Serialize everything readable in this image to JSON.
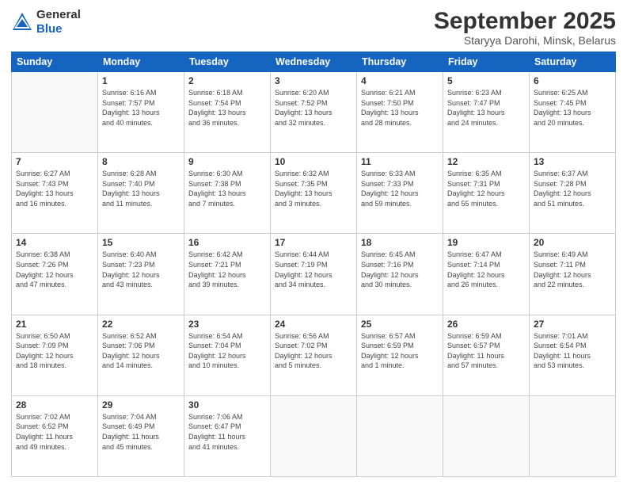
{
  "header": {
    "logo_line1": "General",
    "logo_line2": "Blue",
    "month": "September 2025",
    "location": "Staryya Darohi, Minsk, Belarus"
  },
  "weekdays": [
    "Sunday",
    "Monday",
    "Tuesday",
    "Wednesday",
    "Thursday",
    "Friday",
    "Saturday"
  ],
  "weeks": [
    [
      {
        "day": "",
        "text": ""
      },
      {
        "day": "1",
        "text": "Sunrise: 6:16 AM\nSunset: 7:57 PM\nDaylight: 13 hours\nand 40 minutes."
      },
      {
        "day": "2",
        "text": "Sunrise: 6:18 AM\nSunset: 7:54 PM\nDaylight: 13 hours\nand 36 minutes."
      },
      {
        "day": "3",
        "text": "Sunrise: 6:20 AM\nSunset: 7:52 PM\nDaylight: 13 hours\nand 32 minutes."
      },
      {
        "day": "4",
        "text": "Sunrise: 6:21 AM\nSunset: 7:50 PM\nDaylight: 13 hours\nand 28 minutes."
      },
      {
        "day": "5",
        "text": "Sunrise: 6:23 AM\nSunset: 7:47 PM\nDaylight: 13 hours\nand 24 minutes."
      },
      {
        "day": "6",
        "text": "Sunrise: 6:25 AM\nSunset: 7:45 PM\nDaylight: 13 hours\nand 20 minutes."
      }
    ],
    [
      {
        "day": "7",
        "text": "Sunrise: 6:27 AM\nSunset: 7:43 PM\nDaylight: 13 hours\nand 16 minutes."
      },
      {
        "day": "8",
        "text": "Sunrise: 6:28 AM\nSunset: 7:40 PM\nDaylight: 13 hours\nand 11 minutes."
      },
      {
        "day": "9",
        "text": "Sunrise: 6:30 AM\nSunset: 7:38 PM\nDaylight: 13 hours\nand 7 minutes."
      },
      {
        "day": "10",
        "text": "Sunrise: 6:32 AM\nSunset: 7:35 PM\nDaylight: 13 hours\nand 3 minutes."
      },
      {
        "day": "11",
        "text": "Sunrise: 6:33 AM\nSunset: 7:33 PM\nDaylight: 12 hours\nand 59 minutes."
      },
      {
        "day": "12",
        "text": "Sunrise: 6:35 AM\nSunset: 7:31 PM\nDaylight: 12 hours\nand 55 minutes."
      },
      {
        "day": "13",
        "text": "Sunrise: 6:37 AM\nSunset: 7:28 PM\nDaylight: 12 hours\nand 51 minutes."
      }
    ],
    [
      {
        "day": "14",
        "text": "Sunrise: 6:38 AM\nSunset: 7:26 PM\nDaylight: 12 hours\nand 47 minutes."
      },
      {
        "day": "15",
        "text": "Sunrise: 6:40 AM\nSunset: 7:23 PM\nDaylight: 12 hours\nand 43 minutes."
      },
      {
        "day": "16",
        "text": "Sunrise: 6:42 AM\nSunset: 7:21 PM\nDaylight: 12 hours\nand 39 minutes."
      },
      {
        "day": "17",
        "text": "Sunrise: 6:44 AM\nSunset: 7:19 PM\nDaylight: 12 hours\nand 34 minutes."
      },
      {
        "day": "18",
        "text": "Sunrise: 6:45 AM\nSunset: 7:16 PM\nDaylight: 12 hours\nand 30 minutes."
      },
      {
        "day": "19",
        "text": "Sunrise: 6:47 AM\nSunset: 7:14 PM\nDaylight: 12 hours\nand 26 minutes."
      },
      {
        "day": "20",
        "text": "Sunrise: 6:49 AM\nSunset: 7:11 PM\nDaylight: 12 hours\nand 22 minutes."
      }
    ],
    [
      {
        "day": "21",
        "text": "Sunrise: 6:50 AM\nSunset: 7:09 PM\nDaylight: 12 hours\nand 18 minutes."
      },
      {
        "day": "22",
        "text": "Sunrise: 6:52 AM\nSunset: 7:06 PM\nDaylight: 12 hours\nand 14 minutes."
      },
      {
        "day": "23",
        "text": "Sunrise: 6:54 AM\nSunset: 7:04 PM\nDaylight: 12 hours\nand 10 minutes."
      },
      {
        "day": "24",
        "text": "Sunrise: 6:56 AM\nSunset: 7:02 PM\nDaylight: 12 hours\nand 5 minutes."
      },
      {
        "day": "25",
        "text": "Sunrise: 6:57 AM\nSunset: 6:59 PM\nDaylight: 12 hours\nand 1 minute."
      },
      {
        "day": "26",
        "text": "Sunrise: 6:59 AM\nSunset: 6:57 PM\nDaylight: 11 hours\nand 57 minutes."
      },
      {
        "day": "27",
        "text": "Sunrise: 7:01 AM\nSunset: 6:54 PM\nDaylight: 11 hours\nand 53 minutes."
      }
    ],
    [
      {
        "day": "28",
        "text": "Sunrise: 7:02 AM\nSunset: 6:52 PM\nDaylight: 11 hours\nand 49 minutes."
      },
      {
        "day": "29",
        "text": "Sunrise: 7:04 AM\nSunset: 6:49 PM\nDaylight: 11 hours\nand 45 minutes."
      },
      {
        "day": "30",
        "text": "Sunrise: 7:06 AM\nSunset: 6:47 PM\nDaylight: 11 hours\nand 41 minutes."
      },
      {
        "day": "",
        "text": ""
      },
      {
        "day": "",
        "text": ""
      },
      {
        "day": "",
        "text": ""
      },
      {
        "day": "",
        "text": ""
      }
    ]
  ]
}
